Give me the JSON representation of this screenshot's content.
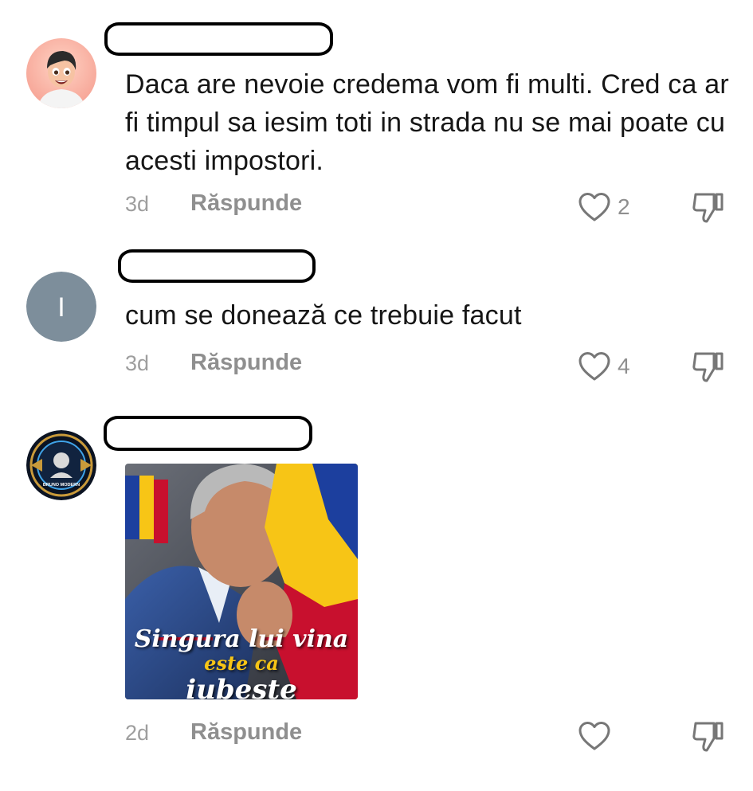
{
  "reply_label": "Răspunde",
  "comments": [
    {
      "avatar": "cartoon-boy-avatar",
      "text": "Daca are nevoie credema vom fi multi. Cred ca ar fi timpul sa iesim toti in strada nu se mai poate cu acesti impostori.",
      "time": "3d",
      "likes": "2"
    },
    {
      "avatar_initial": "I",
      "avatar_color": "#7d8e9b",
      "text": "cum se donează ce trebuie facut",
      "time": "3d",
      "likes": "4"
    },
    {
      "avatar": "bruno-modern-emblem-avatar",
      "avatar_text": "BRUNO MODERN",
      "image_caption_line1": "Singura lui vina",
      "image_caption_line2": "este ca",
      "image_caption_line3": "iubește România",
      "time": "2d",
      "likes": ""
    }
  ],
  "colors": {
    "text": "#161616",
    "meta": "#9e9e9e",
    "flag_blue": "#1c3f9e",
    "flag_yellow": "#f7c516",
    "flag_red": "#c8102e"
  }
}
